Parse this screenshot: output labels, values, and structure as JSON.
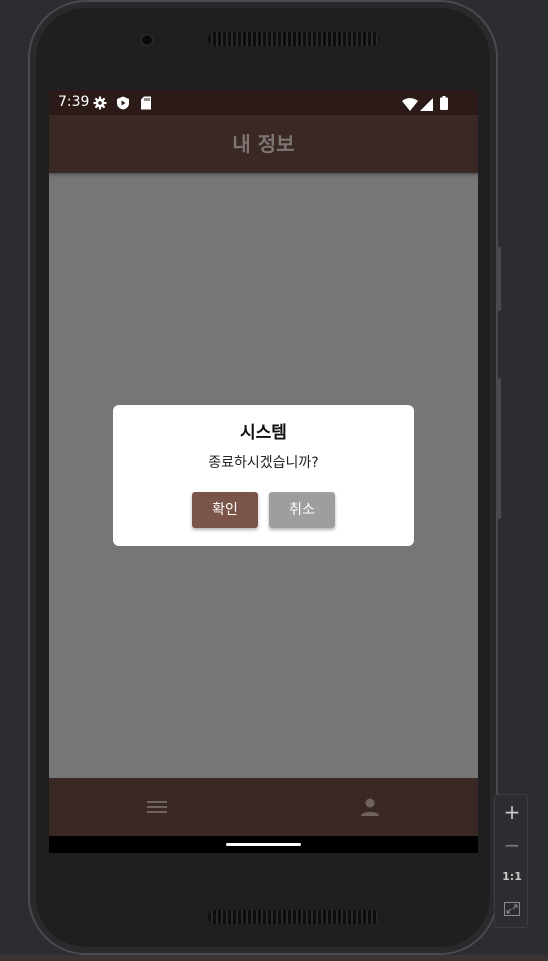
{
  "status_bar": {
    "time": "7:39",
    "icons": [
      "gear-icon",
      "play-protect-icon",
      "sd-card-icon",
      "wifi-icon",
      "signal-icon",
      "battery-icon"
    ]
  },
  "app_bar": {
    "title": "내 정보"
  },
  "dialog": {
    "title": "시스템",
    "message": "종료하시겠습니까?",
    "confirm_label": "확인",
    "cancel_label": "취소"
  },
  "bottom_nav": {
    "items": [
      "menu-icon",
      "person-icon"
    ]
  },
  "emulator_controls": {
    "zoom_in": "+",
    "zoom_out": "−",
    "actual_size": "1:1"
  },
  "colors": {
    "app_bar": "#3a2824",
    "status_bar": "#2b1a17",
    "confirm_button": "#7a5448",
    "cancel_button": "#9e9e9e",
    "scrim": "#767676"
  }
}
